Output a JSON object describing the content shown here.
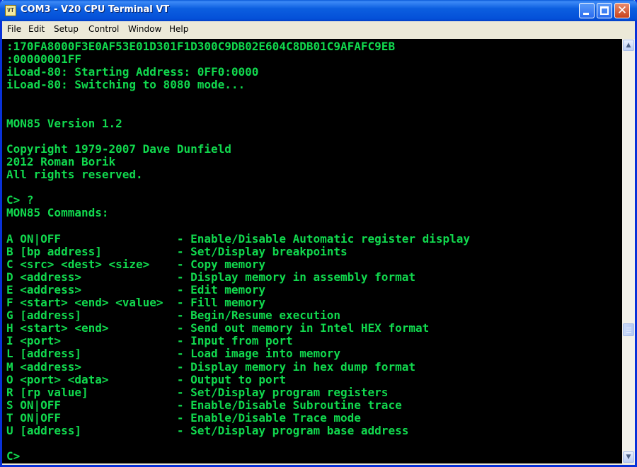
{
  "window": {
    "title": "COM3 - V20 CPU Terminal VT",
    "app_icon": "terminal-app-icon"
  },
  "menu": {
    "items": [
      "File",
      "Edit",
      "Setup",
      "Control",
      "Window",
      "Help"
    ]
  },
  "terminal": {
    "text_color": "#11d94e",
    "background": "#000000",
    "lines": [
      ":170FA8000F3E0AF53E01D301F1D300C9DB02E604C8DB01C9AFAFC9EB",
      ":00000001FF",
      "iLoad-80: Starting Address: 0FF0:0000",
      "iLoad-80: Switching to 8080 mode...",
      "",
      "",
      "MON85 Version 1.2",
      "",
      "Copyright 1979-2007 Dave Dunfield",
      "2012 Roman Borik",
      "All rights reserved.",
      "",
      "C> ?",
      "MON85 Commands:",
      "",
      "A ON|OFF                 - Enable/Disable Automatic register display",
      "B [bp address]           - Set/Display breakpoints",
      "C <src> <dest> <size>    - Copy memory",
      "D <address>              - Display memory in assembly format",
      "E <address>              - Edit memory",
      "F <start> <end> <value>  - Fill memory",
      "G [address]              - Begin/Resume execution",
      "H <start> <end>          - Send out memory in Intel HEX format",
      "I <port>                 - Input from port",
      "L [address]              - Load image into memory",
      "M <address>              - Display memory in hex dump format",
      "O <port> <data>          - Output to port",
      "R [rp value]             - Set/Display program registers",
      "S ON|OFF                 - Enable/Disable Subroutine trace",
      "T ON|OFF                 - Enable/Disable Trace mode",
      "U [address]              - Set/Display program base address",
      "",
      "C>"
    ]
  },
  "scrollbar": {
    "up_icon": "scroll-up-arrow-icon",
    "down_icon": "scroll-down-arrow-icon",
    "position": 0.7
  }
}
